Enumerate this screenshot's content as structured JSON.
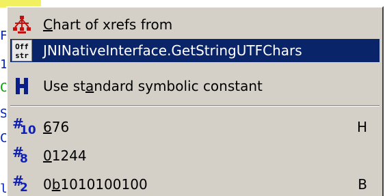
{
  "background_fragments": [
    {
      "char": "F"
    },
    {
      "char": "1"
    },
    {
      "char": "C"
    },
    {
      "char": "S"
    },
    {
      "char": "C"
    },
    {
      "char": "l"
    }
  ],
  "menu": {
    "items": [
      {
        "label_pre": "",
        "label_u": "C",
        "label_post": "hart of xrefs from",
        "shortcut": "",
        "icon": "xref-chart-icon",
        "selected": false
      },
      {
        "label_pre": "",
        "label_u": "J",
        "label_post": "NINativeInterface.GetStringUTFChars",
        "shortcut": "",
        "icon": "offset-struct-icon",
        "selected": true
      },
      {
        "label_pre": "Use st",
        "label_u": "a",
        "label_post": "ndard symbolic constant",
        "shortcut": "",
        "icon": "symbolic-constant-icon",
        "selected": false
      },
      {
        "label_pre": "",
        "label_u": "6",
        "label_post": "76",
        "shortcut": "H",
        "icon": "decimal-radix-icon",
        "radix_sub": "10",
        "selected": false
      },
      {
        "label_pre": "",
        "label_u": "0",
        "label_post": "1244",
        "shortcut": "",
        "icon": "octal-radix-icon",
        "radix_sub": "8",
        "selected": false
      },
      {
        "label_pre": "0",
        "label_u": "b",
        "label_post": "1010100100",
        "shortcut": "B",
        "icon": "binary-radix-icon",
        "radix_sub": "2",
        "selected": false
      }
    ],
    "offstr_icon_text": [
      "Off",
      "str"
    ]
  },
  "colors": {
    "menu_bg": "#d4d0c8",
    "selection_bg": "#0a246a",
    "radix_icon": "#1020b0",
    "xref_icon": "#c01010"
  }
}
